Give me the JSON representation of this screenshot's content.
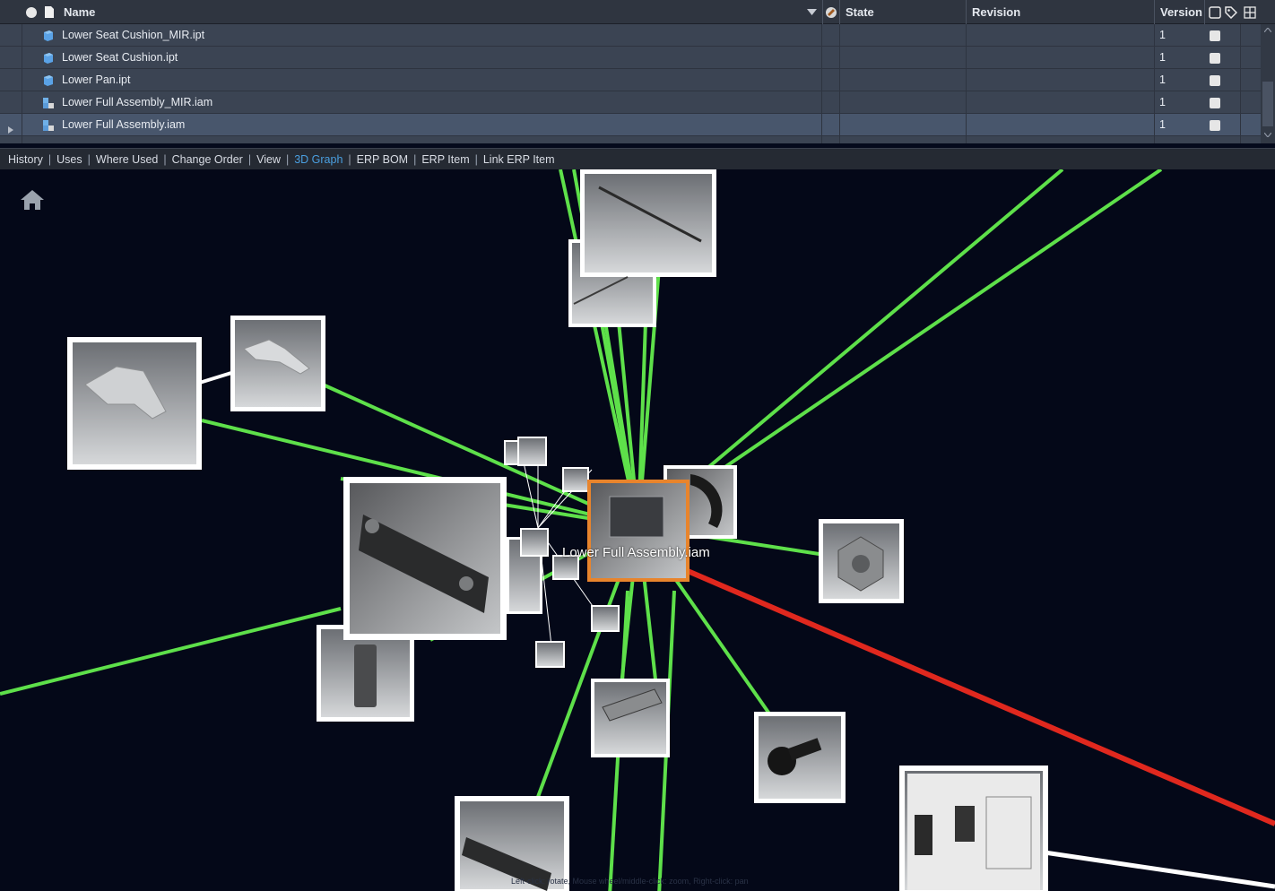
{
  "grid": {
    "headers": {
      "name": "Name",
      "state": "State",
      "revision": "Revision",
      "version": "Version"
    },
    "rows": [
      {
        "name": "Lower Seat Cushion_MIR.ipt",
        "version": "1",
        "type": "part"
      },
      {
        "name": "Lower Seat Cushion.ipt",
        "version": "1",
        "type": "part"
      },
      {
        "name": "Lower Pan.ipt",
        "version": "1",
        "type": "part"
      },
      {
        "name": "Lower Full Assembly_MIR.iam",
        "version": "1",
        "type": "assembly"
      },
      {
        "name": "Lower Full Assembly.iam",
        "version": "1",
        "type": "assembly",
        "selected": true
      }
    ]
  },
  "tabs": [
    {
      "label": "History"
    },
    {
      "label": "Uses"
    },
    {
      "label": "Where Used"
    },
    {
      "label": "Change Order"
    },
    {
      "label": "View"
    },
    {
      "label": "3D Graph",
      "active": true
    },
    {
      "label": "ERP BOM"
    },
    {
      "label": "ERP Item"
    },
    {
      "label": "Link ERP Item"
    }
  ],
  "graph": {
    "tooltip": "Lower Full Assembly.iam",
    "hint": "Left-click: rotate, Mouse wheel/middle-click: zoom, Right-click: pan",
    "colors": {
      "child_link": "#5ee04a",
      "parent_link": "#e0281e",
      "selected_border": "#e8842c",
      "node_border": "#ffffff",
      "background": "#040818"
    },
    "icons": {
      "home": "home-icon"
    }
  }
}
